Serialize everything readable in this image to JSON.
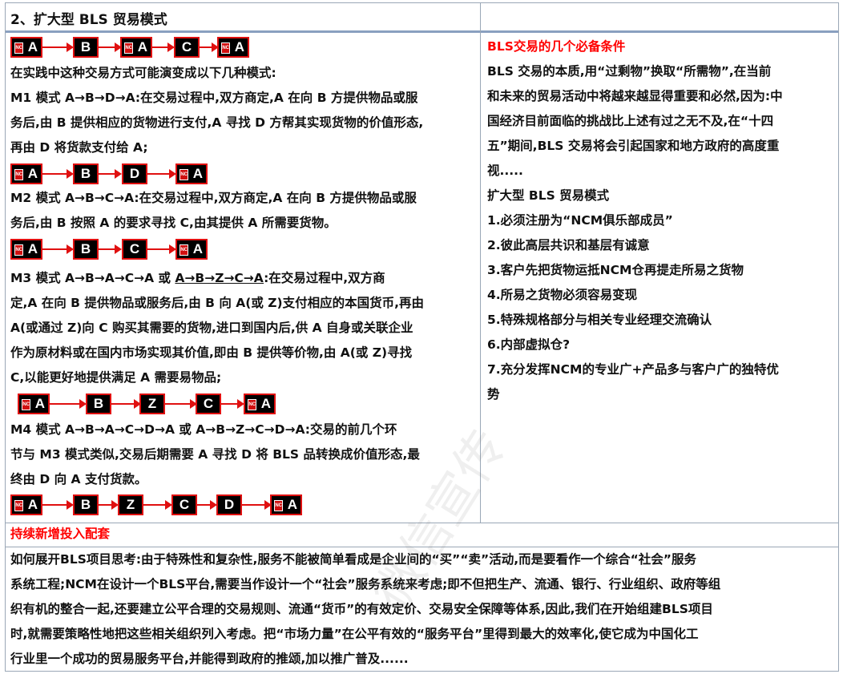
{
  "header": {
    "title": "2、扩大型 BLS 贸易模式"
  },
  "node_labels": {
    "a": "A",
    "b": "B",
    "c": "C",
    "d": "D",
    "z": "Z",
    "logo": "NC"
  },
  "left": {
    "intro": "在实践中这种交易方式可能演变成以下几种模式:",
    "m1": [
      "M1 模式 A→B→D→A:在交易过程中,双方商定,A 在向 B 方提供物品或服",
      "务后,由 B 提供相应的货物进行支付,A 寻找 D 方帮其实现货物的价值形态,",
      "再由 D 将货款支付给 A;"
    ],
    "m2": [
      "M2 模式 A→B→C→A:在交易过程中,双方商定,A 在向 B 方提供物品或服",
      "务后,由 B 按照 A 的要求寻找 C,由其提供 A 所需要货物。"
    ],
    "m3_a": "M3 模式 A→B→A→C→A 或 ",
    "m3_u": "A→B→Z→C→A",
    "m3_b": ":在交易过程中,双方商",
    "m3": [
      "定,A 在向 B 提供物品或服务后,由 B 向 A(或 Z)支付相应的本国货币,再由",
      "A(或通过 Z)向 C 购买其需要的货物,进口到国内后,供 A 自身或关联企业",
      "作为原材料或在国内市场实现其价值,即由 B 提供等价物,由 A(或 Z)寻找",
      "C,以能更好地提供满足 A 需要易物品;"
    ],
    "m4": [
      "M4 模式 A→B→A→C→D→A 或 A→B→Z→C→D→A:交易的前几个环",
      "节与 M3 模式类似,交易后期需要 A 寻找 D 将 BLS 品转换成价值形态,最",
      "终由 D 向 A 支付货款。"
    ]
  },
  "right": {
    "heading": "BLS交易的几个必备条件",
    "para": [
      "BLS 交易的本质,用“过剩物”换取“所需物”,在当前",
      "和未来的贸易活动中将越来越显得重要和必然,因为:中",
      "国经济目前面临的挑战比上述有过之无不及,在“十四",
      "五”期间,BLS 交易将会引起国家和地方政府的高度重",
      "视....."
    ],
    "subhead": "扩大型 BLS 贸易模式",
    "items": [
      "1.必须注册为“NCM俱乐部成员”",
      "2.彼此高层共识和基层有诚意",
      "3.客户先把货物运抵NCM仓再提走所易之货物",
      "4.所易之货物必须容易变现",
      "5.特殊规格部分与相关专业经理交流确认",
      "6.内部虚拟仓?",
      "7.充分发挥NCM的专业广+产品多与客户广的独特优",
      "势"
    ]
  },
  "bottom": {
    "heading": "持续新增投入配套",
    "para": [
      "如何展开BLS项目思考:由于特殊性和复杂性,服务不能被简单看成是企业间的“买”“卖”活动,而是要看作一个综合“社会”服务",
      "系统工程;NCM在设计一个BLS平台,需要当作设计一个“社会”服务系统来考虑;即不但把生产、流通、银行、行业组织、政府等组",
      "织有机的整合一起,还要建立公平合理的交易规则、流通“货币”的有效定价、交易安全保障等体系,因此,我们在开始组建BLS项目",
      "时,就需要策略性地把这些相关组织列入考虑。把“市场力量”在公平有效的“服务平台”里得到最大的效率化,使它成为中国化工",
      "行业里一个成功的贸易服务平台,并能得到政府的推颂,加以推广普及......"
    ]
  },
  "watermark": "微信宣传"
}
